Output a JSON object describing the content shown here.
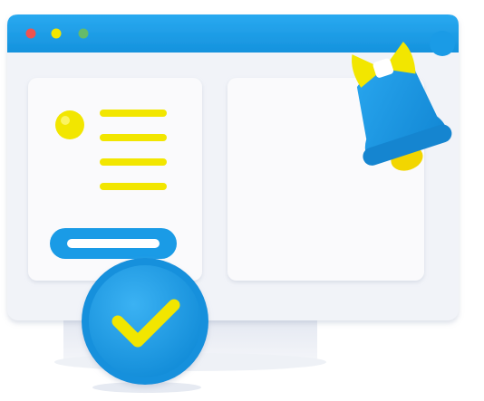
{
  "illustration": {
    "theme_colors": {
      "primary_blue": "#1A9BE6",
      "accent_yellow": "#F2E600",
      "panel_grey": "#F1F3F8",
      "card_white": "#FAFAFC",
      "dot_red": "#EF5350",
      "dot_yellow": "#F2E600",
      "dot_green": "#66BB6A"
    },
    "window": {
      "traffic_lights": [
        "red",
        "yellow",
        "green"
      ]
    },
    "icons": [
      "notification-bell-icon",
      "checkmark-badge-icon"
    ]
  }
}
